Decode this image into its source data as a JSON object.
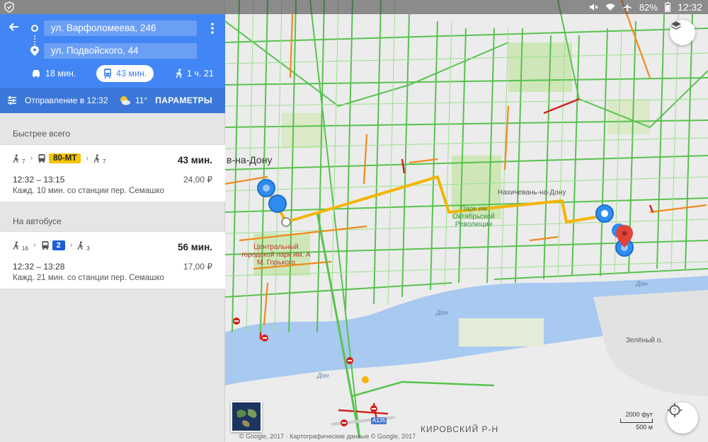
{
  "status_bar": {
    "battery": "82%",
    "time": "12:32"
  },
  "route": {
    "origin": "ул. Варфоломеева, 246",
    "destination": "ул. Подвойского, 44"
  },
  "modes": [
    {
      "name": "car",
      "icon": "car-icon",
      "time": "18 мин.",
      "selected": false
    },
    {
      "name": "transit",
      "icon": "train-icon",
      "time": "43 мин.",
      "selected": true
    },
    {
      "name": "walk",
      "icon": "walk-icon",
      "time": "1 ч. 21",
      "selected": false
    }
  ],
  "depart": {
    "text": "Отправление в 12:32",
    "temperature": "11°",
    "params_label": "ПАРАМЕТРЫ"
  },
  "sections": [
    {
      "title": "Быстрее всего",
      "walk_before": "7",
      "bus_label": "80-МТ",
      "walk_after": "7",
      "duration": "43 мин.",
      "times": "12:32 – 13:15",
      "price": "24,00 ₽",
      "frequency": "Кажд. 10 мин. со станции пер. Семашко"
    },
    {
      "title": "На автобусе",
      "walk_before": "16",
      "bus_label": "2",
      "walk_after": "3",
      "duration": "56 мин.",
      "times": "12:32 – 13:28",
      "price": "17,00 ₽",
      "frequency": "Кажд. 21 мин. со станции пер. Семашко"
    }
  ],
  "map": {
    "city_label": "в-на-Дону",
    "park1": "Парк им Октябрьской Революции",
    "park2": "Центральный городской парк им. А М. Горького",
    "nakhichevan": "Нахичевань-на-Дону",
    "river_labels": [
      "Дон",
      "Дон",
      "Дон"
    ],
    "island": "Зелёный о.",
    "district": "КИРОВСКИЙ Р-Н",
    "road_a135": "A135",
    "scale_ft": "2000 фут",
    "scale_m": "500 м",
    "copyright": "© Google, 2017 · Картографические данные © Google, 2017",
    "colors": {
      "route": "#f4b400",
      "traffic_green": "#58c24e",
      "traffic_orange": "#f08a1c",
      "traffic_red": "#d0211c",
      "water": "#a8c9f0",
      "park": "#cfe7b8",
      "stop_blue": "#2f8cf0"
    }
  }
}
